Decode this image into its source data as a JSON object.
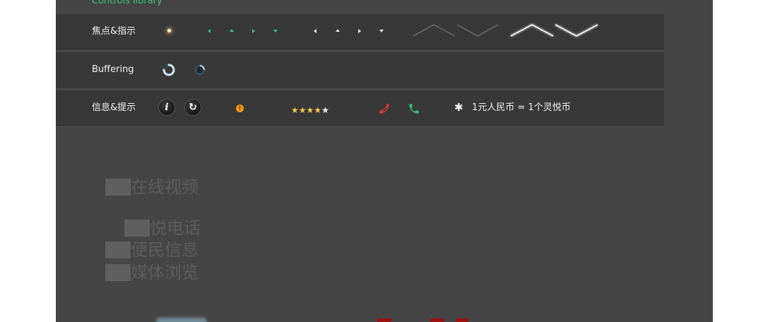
{
  "library_title": "Controls library",
  "rows": {
    "focus": {
      "label": "焦点&指示"
    },
    "buffering": {
      "label": "Buffering"
    },
    "info": {
      "label": "信息&提示",
      "info_glyph": "i",
      "refresh_glyph": "↻",
      "warning_glyph": "!",
      "rating": 4,
      "rating_max": 5,
      "exchange_text": "1元人民币 = 1个灵悦币",
      "asterisk": "✱"
    }
  },
  "menu": {
    "items": [
      "在线视频",
      "悦电话",
      "便民信息",
      "媒体浏览"
    ]
  },
  "colors": {
    "accent_green": "#39c27a",
    "arrow_teal": "#2ec285",
    "decline_red": "#d0393a",
    "accept_green": "#2fbf73",
    "star_gold": "#f4c94a",
    "warning_orange": "#f39a1a"
  }
}
